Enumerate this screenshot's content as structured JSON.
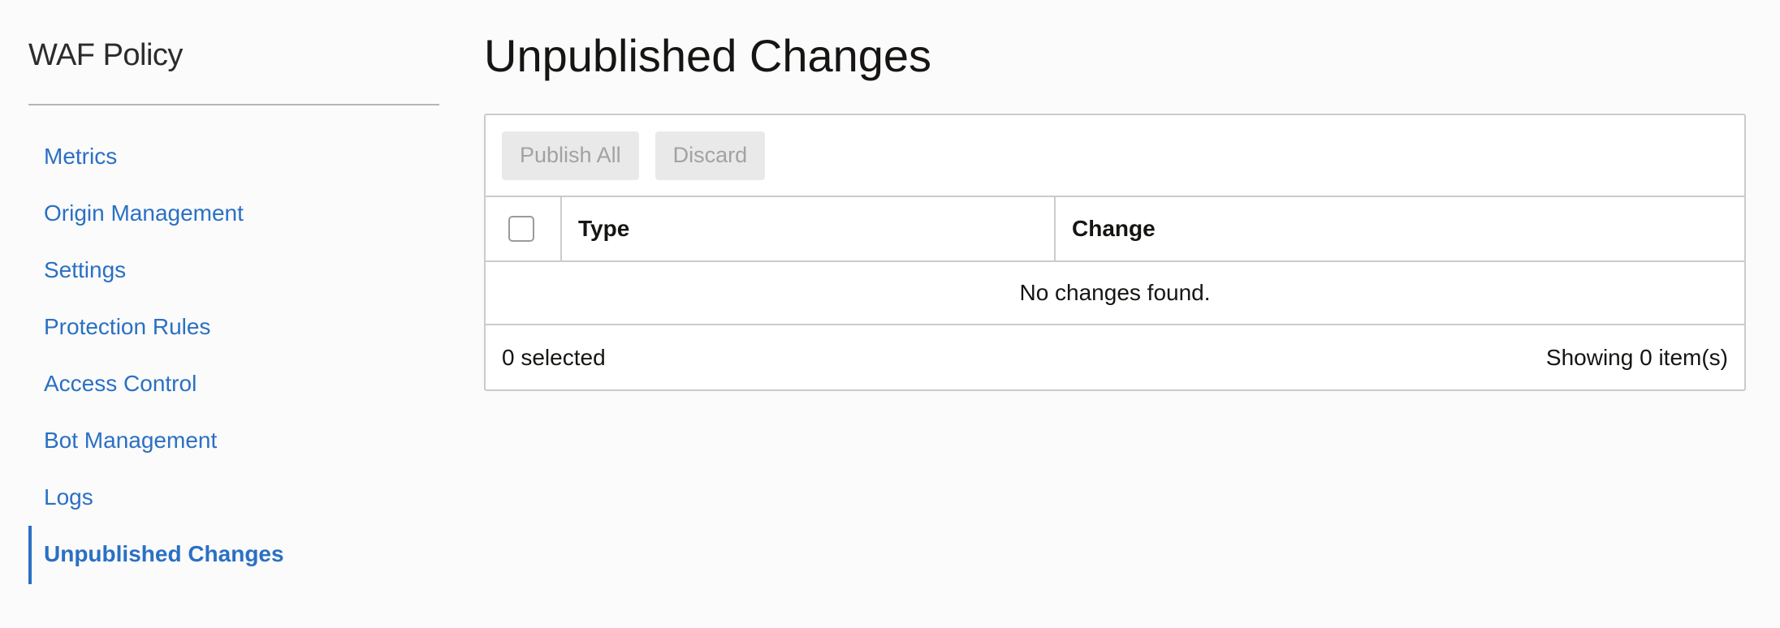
{
  "sidebar": {
    "title": "WAF Policy",
    "items": [
      {
        "label": "Metrics"
      },
      {
        "label": "Origin Management"
      },
      {
        "label": "Settings"
      },
      {
        "label": "Protection Rules"
      },
      {
        "label": "Access Control"
      },
      {
        "label": "Bot Management"
      },
      {
        "label": "Logs"
      },
      {
        "label": "Unpublished Changes",
        "active": true
      }
    ]
  },
  "main": {
    "title": "Unpublished Changes",
    "toolbar": {
      "publish_all_label": "Publish All",
      "discard_label": "Discard"
    },
    "table": {
      "columns": [
        "Type",
        "Change"
      ],
      "empty_message": "No changes found."
    },
    "footer": {
      "selected_text": "0 selected",
      "showing_text": "Showing 0 item(s)"
    }
  },
  "colors": {
    "link": "#2a70c4",
    "border": "#cbcbcb",
    "disabled_button_bg": "#e9e9e9",
    "disabled_button_text": "#a2a2a2"
  }
}
